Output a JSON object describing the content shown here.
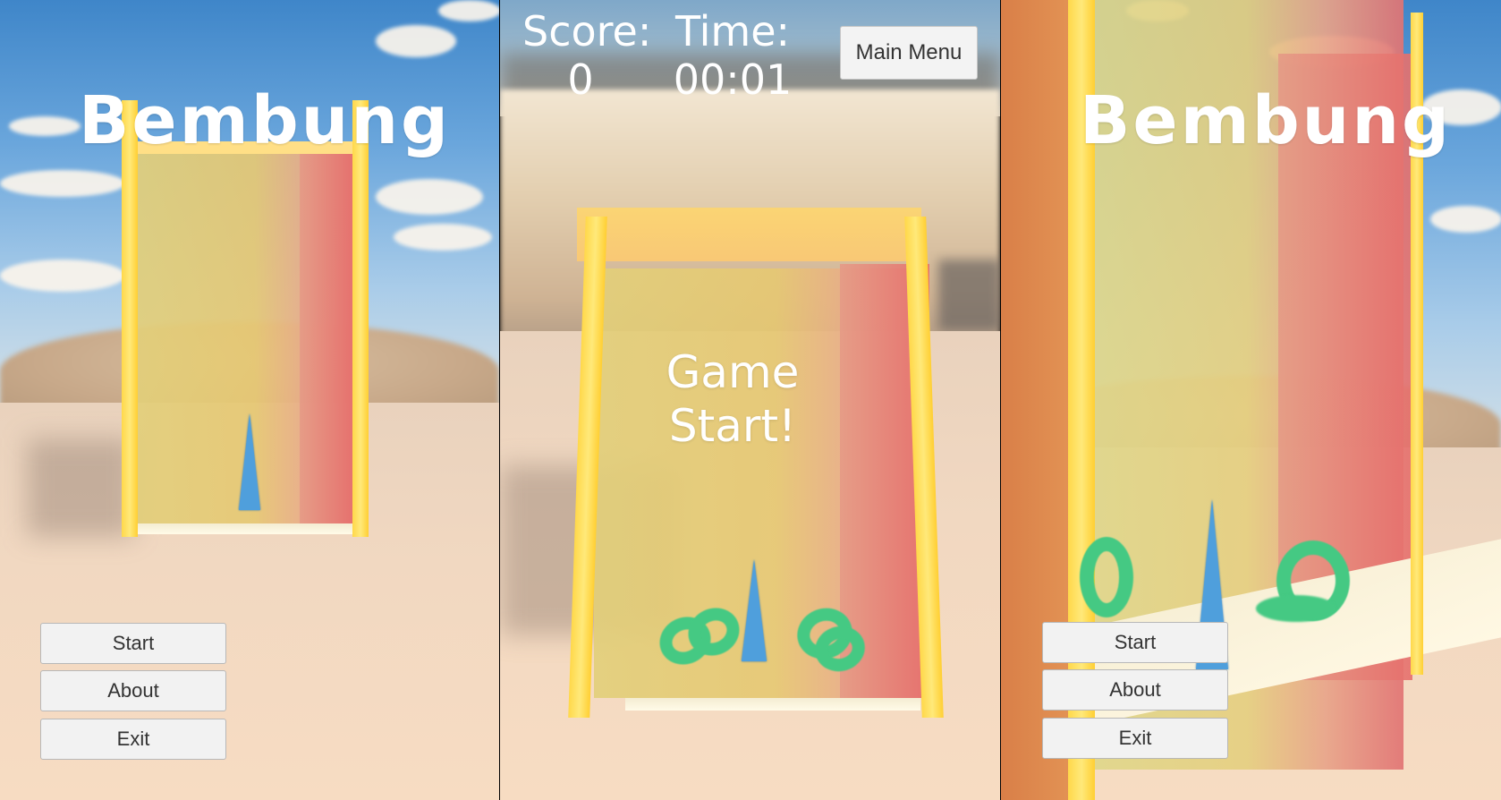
{
  "title_screen": {
    "game_title": "Bembung",
    "menu": [
      "Start",
      "About",
      "Exit"
    ]
  },
  "gameplay": {
    "score_label": "Score:",
    "score_value": "0",
    "time_label": "Time:",
    "time_value": "00:01",
    "main_menu_label": "Main Menu",
    "message_line1": "Game",
    "message_line2": "Start!"
  },
  "title_screen_alt": {
    "game_title": "Bembung",
    "menu": [
      "Start",
      "About",
      "Exit"
    ]
  },
  "colors": {
    "frame_yellow": "#ffd84a",
    "wall_red": "#e66f6c",
    "cone_blue": "#4f9fdc",
    "ring_green": "#45c983"
  }
}
